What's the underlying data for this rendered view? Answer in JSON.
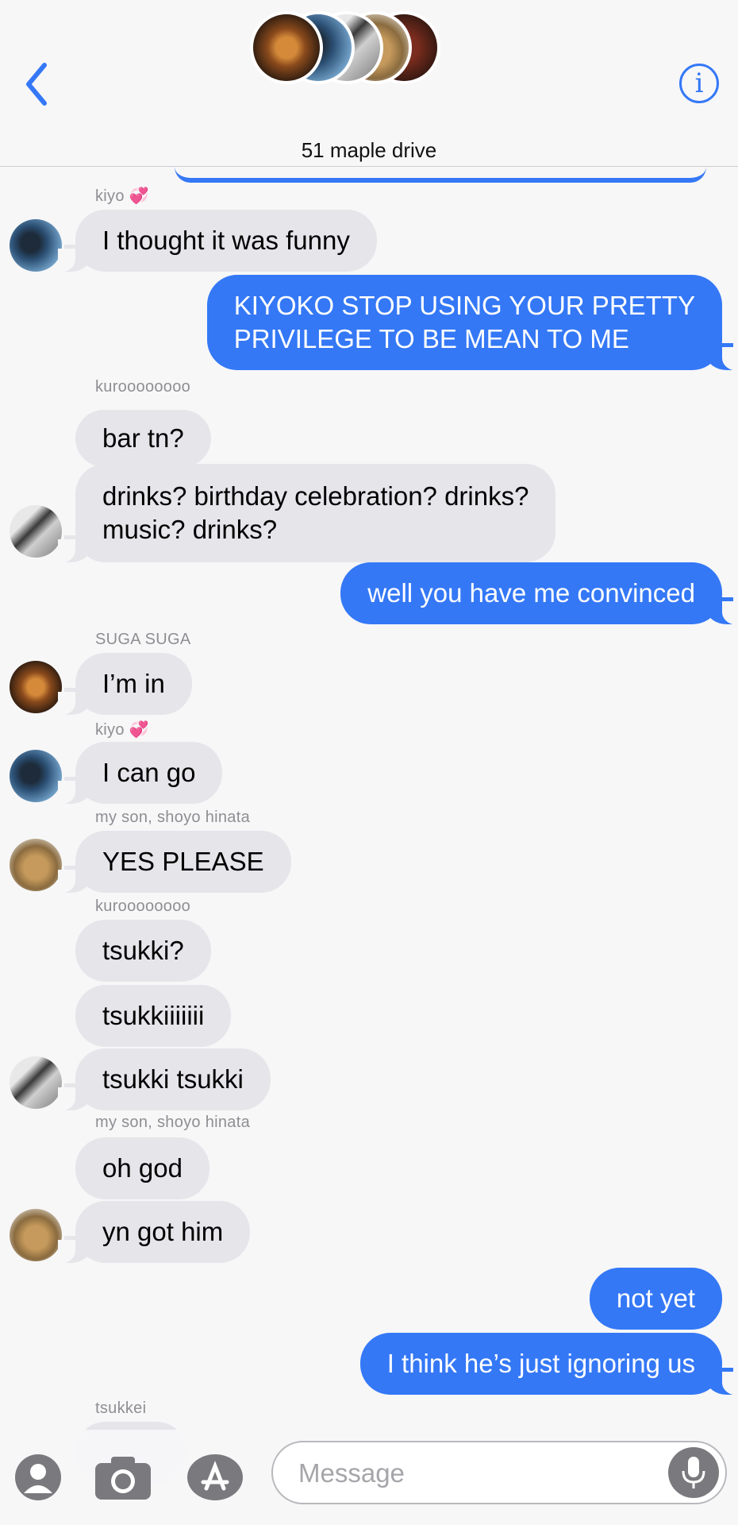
{
  "header": {
    "title": "51 maple drive",
    "back_label": "<",
    "info_label": "i"
  },
  "messages": [
    {
      "sender": "kiyo",
      "sender_emoji": "💞",
      "text": "I thought it was funny",
      "dir": "in",
      "avatar": "kiyo"
    },
    {
      "text_lines": [
        "KIYOKO STOP USING YOUR PRETTY",
        "PRIVILEGE TO BE MEAN TO ME"
      ],
      "dir": "out"
    },
    {
      "sender": "kuroooooooo",
      "text": "bar tn?",
      "dir": "in"
    },
    {
      "text_lines": [
        "drinks? birthday celebration? drinks?",
        "music? drinks?"
      ],
      "dir": "in",
      "avatar": "kuro"
    },
    {
      "text": "well you have me convinced",
      "dir": "out"
    },
    {
      "sender": "SUGA SUGA",
      "text": "I’m in",
      "dir": "in",
      "avatar": "suga"
    },
    {
      "sender": "kiyo",
      "sender_emoji": "💞",
      "text": "I can go",
      "dir": "in",
      "avatar": "kiyo"
    },
    {
      "sender": "my son, shoyo hinata",
      "text": "YES PLEASE",
      "dir": "in",
      "avatar": "hinata"
    },
    {
      "sender": "kuroooooooo",
      "text": "tsukki?",
      "dir": "in"
    },
    {
      "text": "tsukkiiiiiii",
      "dir": "in"
    },
    {
      "text": "tsukki tsukki",
      "dir": "in",
      "avatar": "kuro"
    },
    {
      "sender": "my son, shoyo hinata",
      "text": "oh god",
      "dir": "in"
    },
    {
      "text": "yn got him",
      "dir": "in",
      "avatar": "hinata"
    },
    {
      "text": "not yet",
      "dir": "out"
    },
    {
      "text": "I think he’s just ignoring us",
      "dir": "out"
    },
    {
      "sender": "tsukkei",
      "dir": "in"
    }
  ],
  "compose": {
    "placeholder": "Message",
    "icons": [
      "contact-icon",
      "camera-icon",
      "app-store-icon",
      "microphone-icon"
    ]
  },
  "colors": {
    "accent": "#3478f6",
    "incoming_bubble": "#e5e5ea",
    "background": "#f7f7f8"
  }
}
